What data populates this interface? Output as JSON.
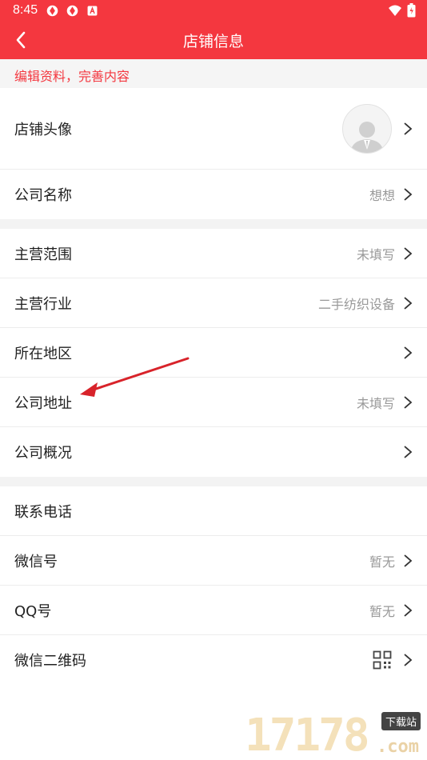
{
  "status_bar": {
    "time": "8:45"
  },
  "app_bar": {
    "title": "店铺信息"
  },
  "hint": "编辑资料，完善内容",
  "groups": [
    {
      "rows": [
        {
          "label": "店铺头像",
          "value": ""
        },
        {
          "label": "公司名称",
          "value": "想想"
        }
      ]
    },
    {
      "rows": [
        {
          "label": "主营范围",
          "value": "未填写"
        },
        {
          "label": "主营行业",
          "value": "二手纺织设备"
        },
        {
          "label": "所在地区",
          "value": ""
        },
        {
          "label": "公司地址",
          "value": "未填写"
        },
        {
          "label": "公司概况",
          "value": ""
        }
      ]
    },
    {
      "rows": [
        {
          "label": "联系电话",
          "value": ""
        },
        {
          "label": "微信号",
          "value": "暂无"
        },
        {
          "label": "QQ号",
          "value": "暂无"
        },
        {
          "label": "微信二维码",
          "value": ""
        }
      ]
    }
  ],
  "watermark": {
    "digits": "17178",
    "tag": "下载站",
    "suffix": ".com"
  },
  "colors": {
    "brand": "#f4373f",
    "value_text": "#999999",
    "annotation_arrow": "#d8232a"
  }
}
